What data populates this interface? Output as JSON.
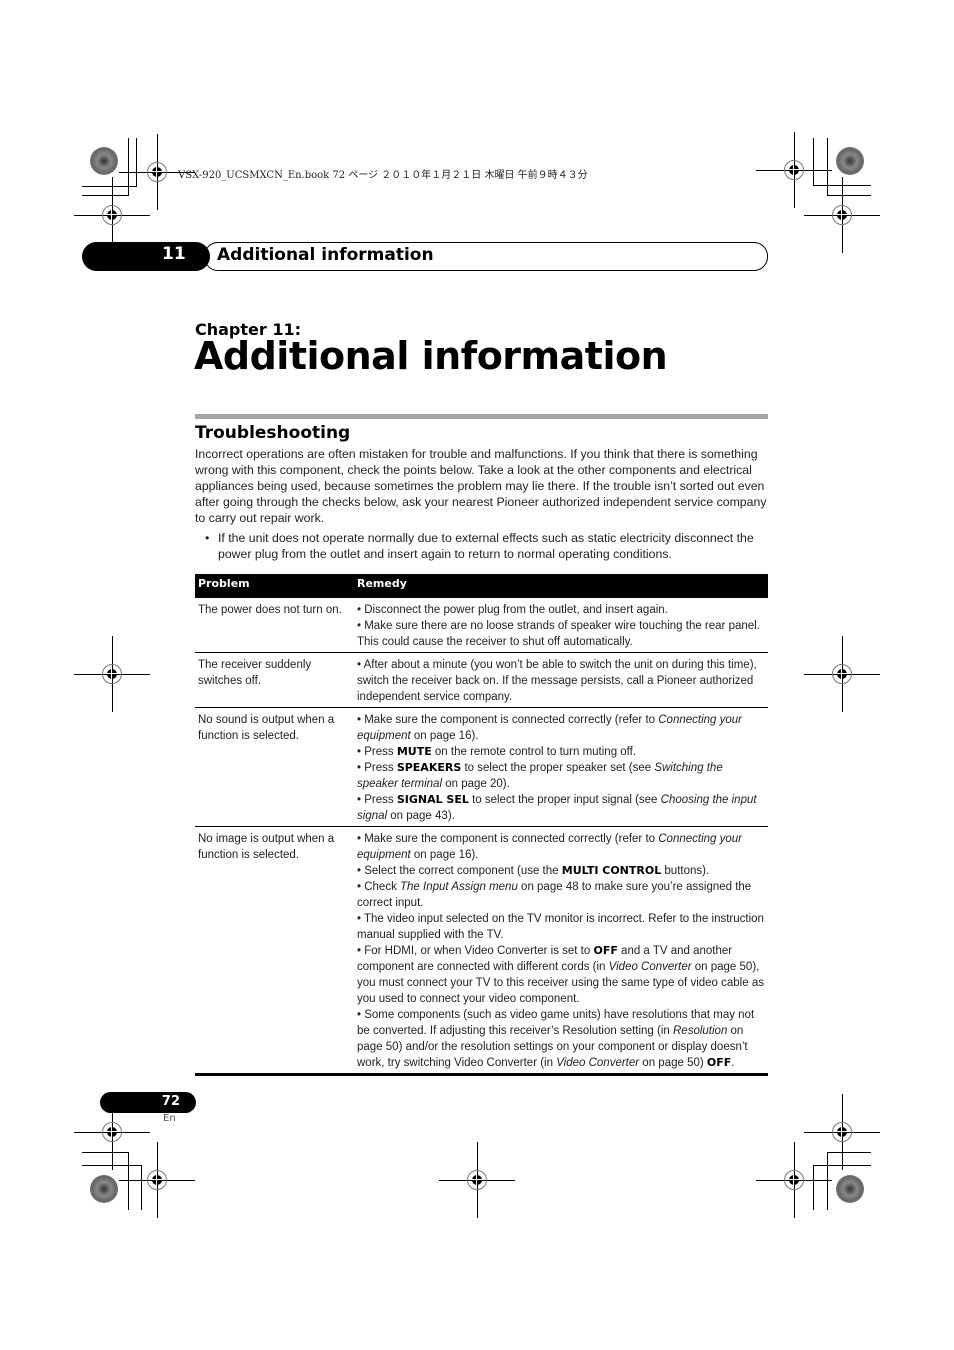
{
  "print_meta": "VSX-920_UCSMXCN_En.book   72 ページ   ２０１０年１月２１日   木曜日   午前９時４３分",
  "header": {
    "chapter_number": "11",
    "title": "Additional information"
  },
  "chapter": {
    "label": "Chapter 11:",
    "title": "Additional information"
  },
  "section": {
    "title": "Troubleshooting",
    "intro": "Incorrect operations are often mistaken for trouble and malfunctions. If you think that there is something wrong with this component, check the points below. Take a look at the other components and electrical appliances being used, because sometimes the problem may lie there. If the trouble isn’t sorted out even after going through the checks below, ask your nearest Pioneer authorized independent service company to carry out repair work.",
    "bullet_symbol": "•",
    "bullet": "If the unit does not operate normally due to external effects such as static electricity disconnect the power plug from the outlet and insert again to return to normal operating conditions."
  },
  "table": {
    "headers": [
      "Problem",
      "Remedy"
    ],
    "rows": [
      {
        "problem": "The power does not turn on.",
        "remedies": [
          [
            {
              "t": "• Disconnect the power plug from the outlet, and insert again."
            }
          ],
          [
            {
              "t": "• Make sure there are no loose strands of speaker wire touching the rear panel. This could cause the receiver to shut off automatically."
            }
          ]
        ]
      },
      {
        "problem": "The receiver suddenly switches off.",
        "remedies": [
          [
            {
              "t": "• After about a minute (you won’t be able to switch the unit on during this time), switch the receiver back on. If the message persists, call a Pioneer authorized independent service company."
            }
          ]
        ]
      },
      {
        "problem": "No sound is output when a function is selected.",
        "remedies": [
          [
            {
              "t": "• Make sure the component is connected correctly (refer to "
            },
            {
              "t": "Connecting your equipment",
              "s": "it"
            },
            {
              "t": " on page 16)."
            }
          ],
          [
            {
              "t": "• Press "
            },
            {
              "t": "MUTE",
              "s": "bold"
            },
            {
              "t": " on the remote control to turn muting off."
            }
          ],
          [
            {
              "t": "• Press "
            },
            {
              "t": "SPEAKERS",
              "s": "bold"
            },
            {
              "t": " to select the proper speaker set (see "
            },
            {
              "t": "Switching the speaker terminal",
              "s": "it"
            },
            {
              "t": " on page 20)."
            }
          ],
          [
            {
              "t": "• Press "
            },
            {
              "t": "SIGNAL SEL",
              "s": "bold"
            },
            {
              "t": " to select the proper input signal (see "
            },
            {
              "t": "Choosing the input signal",
              "s": "it"
            },
            {
              "t": " on page 43)."
            }
          ]
        ]
      },
      {
        "problem": "No image is output when a function is selected.",
        "remedies": [
          [
            {
              "t": "• Make sure the component is connected correctly (refer to "
            },
            {
              "t": "Connecting your equipment",
              "s": "it"
            },
            {
              "t": " on page 16)."
            }
          ],
          [
            {
              "t": "• Select the correct component (use the "
            },
            {
              "t": "MULTI CONTROL",
              "s": "bold"
            },
            {
              "t": " buttons)."
            }
          ],
          [
            {
              "t": "• Check "
            },
            {
              "t": "The Input Assign menu",
              "s": "it"
            },
            {
              "t": " on page 48 to make sure you’re assigned the correct input."
            }
          ],
          [
            {
              "t": "• The video input selected on the TV monitor is incorrect. Refer to the instruction manual supplied with the TV."
            }
          ],
          [
            {
              "t": "• For HDMI, or when Video Converter is set to "
            },
            {
              "t": "OFF",
              "s": "bold"
            },
            {
              "t": " and a TV and another component are connected with different cords (in "
            },
            {
              "t": "Video Converter",
              "s": "it"
            },
            {
              "t": " on page 50), you must connect your TV to this receiver using the same type of video cable as you used to connect your video component."
            }
          ],
          [
            {
              "t": "• Some components (such as video game units) have resolutions that may not be converted. If adjusting this receiver’s Resolution setting (in "
            },
            {
              "t": "Resolution",
              "s": "it"
            },
            {
              "t": " on page 50) and/or the resolution settings on your component or display doesn’t work, try switching Video Converter (in "
            },
            {
              "t": "Video Converter",
              "s": "it"
            },
            {
              "t": " on page 50) "
            },
            {
              "t": "OFF",
              "s": "bold"
            },
            {
              "t": "."
            }
          ]
        ]
      }
    ]
  },
  "footer": {
    "page_number": "72",
    "language": "En"
  }
}
